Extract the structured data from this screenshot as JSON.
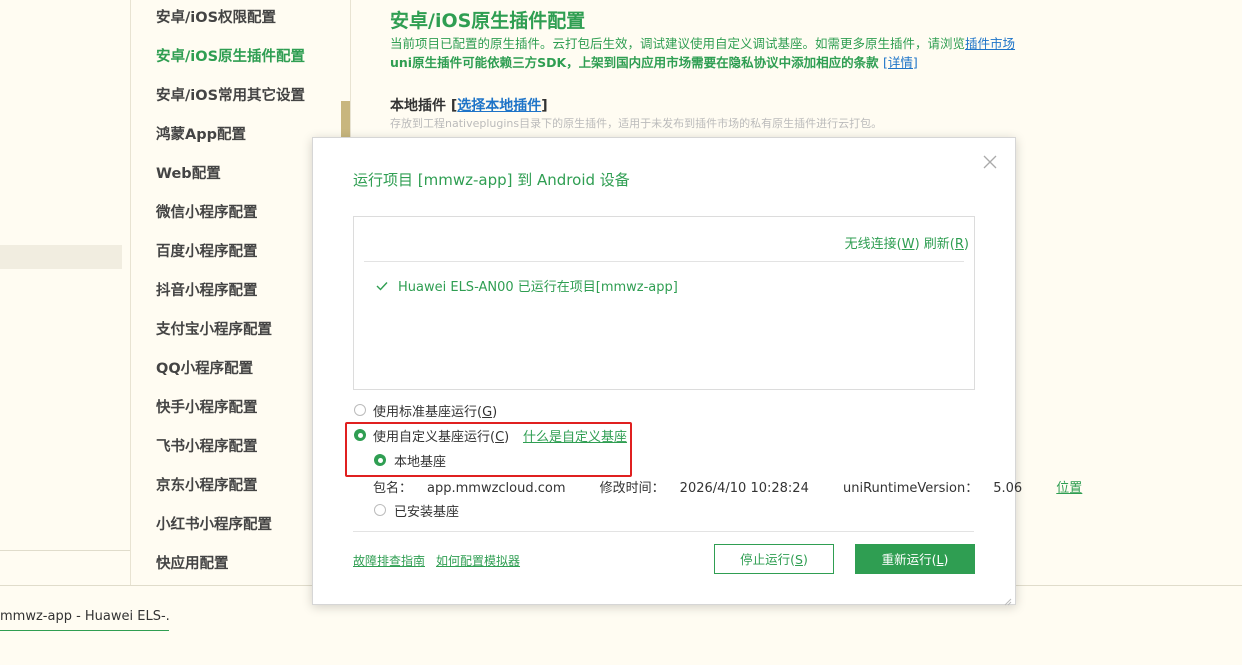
{
  "colors": {
    "accent": "#2f9e52",
    "link": "#1e74c8",
    "highlight_border": "#e02020",
    "background": "#fffcf2"
  },
  "nav": {
    "items": [
      "安卓/iOS权限配置",
      "安卓/iOS原生插件配置",
      "安卓/iOS常用其它设置",
      "鸿蒙App配置",
      "Web配置",
      "微信小程序配置",
      "百度小程序配置",
      "抖音小程序配置",
      "支付宝小程序配置",
      "QQ小程序配置",
      "快手小程序配置",
      "飞书小程序配置",
      "京东小程序配置",
      "小红书小程序配置",
      "快应用配置"
    ],
    "active_index": 1
  },
  "content": {
    "title": "安卓/iOS原生插件配置",
    "desc1_text": "当前项目已配置的原生插件。云打包后生效，调试建议使用自定义调试基座。如需更多原生插件，请浏览",
    "desc1_link": "插件市场",
    "desc2_text": "uni原生插件可能依赖三方SDK，上架到国内应用市场需要在隐私协议中添加相应的条款",
    "desc2_link": "[详情]",
    "local_label": "本地插件",
    "local_link": "选择本地插件",
    "local_bracket_open": "[",
    "local_bracket_close": "]",
    "local_desc": "存放到工程nativeplugins目录下的原生插件，适用于未发布到插件市场的私有原生插件进行云打包。"
  },
  "bottom_tab": "mmwz-app - Huawei ELS-...",
  "dialog": {
    "title": "运行项目 [mmwz-app] 到 Android 设备",
    "wireless_prefix": "无线连接(",
    "wireless_key": "W",
    "wireless_suffix": ")",
    "refresh_prefix": "刷新(",
    "refresh_key": "R",
    "refresh_suffix": ")",
    "device": "Huawei ELS-AN00 已运行在项目[mmwz-app]",
    "opt_standard_prefix": "使用标准基座运行(",
    "opt_standard_key": "G",
    "opt_standard_suffix": ")",
    "opt_custom_prefix": "使用自定义基座运行(",
    "opt_custom_key": "C",
    "opt_custom_suffix": ")",
    "custom_help_link": "什么是自定义基座",
    "opt_local_base": "本地基座",
    "pkg_label": "包名：",
    "pkg_value": "app.mmwzcloud.com",
    "mtime_label": "修改时间：",
    "mtime_value": "2026/4/10 10:28:24",
    "runtime_label": "uniRuntimeVersion：",
    "runtime_value": "5.06",
    "location_link": "位置",
    "opt_installed_base": "已安装基座",
    "troubleshoot_link": "故障排查指南",
    "emulator_link": "如何配置模拟器",
    "stop_prefix": "停止运行(",
    "stop_key": "S",
    "stop_suffix": ")",
    "restart_prefix": "重新运行(",
    "restart_key": "L",
    "restart_suffix": ")"
  }
}
